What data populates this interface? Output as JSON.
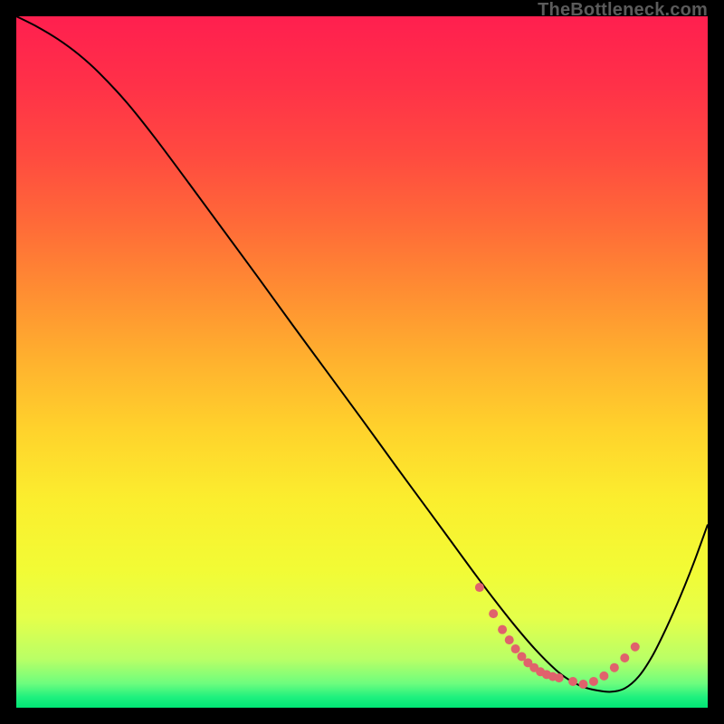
{
  "watermark": "TheBottleneck.com",
  "chart_data": {
    "type": "line",
    "title": "",
    "xlabel": "",
    "ylabel": "",
    "xlim": [
      0,
      100
    ],
    "ylim": [
      0,
      100
    ],
    "background_gradient_stops": [
      {
        "offset": 0.0,
        "color": "#ff1f4f"
      },
      {
        "offset": 0.1,
        "color": "#ff3148"
      },
      {
        "offset": 0.2,
        "color": "#ff4a40"
      },
      {
        "offset": 0.3,
        "color": "#ff6a38"
      },
      {
        "offset": 0.4,
        "color": "#ff8e32"
      },
      {
        "offset": 0.5,
        "color": "#ffb22e"
      },
      {
        "offset": 0.6,
        "color": "#ffd32c"
      },
      {
        "offset": 0.7,
        "color": "#fbee2e"
      },
      {
        "offset": 0.8,
        "color": "#f2fb35"
      },
      {
        "offset": 0.87,
        "color": "#e5ff4a"
      },
      {
        "offset": 0.93,
        "color": "#b9ff66"
      },
      {
        "offset": 0.965,
        "color": "#6dfd7e"
      },
      {
        "offset": 0.985,
        "color": "#1ef07e"
      },
      {
        "offset": 1.0,
        "color": "#00e574"
      }
    ],
    "series": [
      {
        "name": "bottleneck-curve",
        "color": "#000000",
        "x": [
          0,
          3,
          6,
          9,
          12,
          16,
          20,
          25,
          30,
          35,
          40,
          45,
          50,
          55,
          60,
          63,
          66,
          69,
          72,
          75,
          78,
          80,
          82,
          84,
          86,
          88,
          90,
          92,
          94,
          96,
          98,
          100
        ],
        "y": [
          100,
          98.5,
          96.7,
          94.5,
          91.8,
          87.5,
          82.5,
          75.8,
          69.0,
          62.2,
          55.3,
          48.5,
          41.7,
          34.8,
          28.0,
          23.9,
          19.8,
          15.8,
          12.0,
          8.5,
          5.5,
          4.0,
          3.0,
          2.5,
          2.3,
          2.8,
          4.5,
          7.5,
          11.5,
          16.0,
          21.0,
          26.5
        ]
      }
    ],
    "markers": {
      "name": "bottleneck-range",
      "color": "#e0626c",
      "radius_px": 5,
      "x": [
        67.0,
        69.0,
        70.3,
        71.3,
        72.2,
        73.1,
        74.0,
        74.9,
        75.8,
        76.7,
        77.6,
        78.5,
        80.5,
        82.0,
        83.5,
        85.0,
        86.5,
        88.0,
        89.5
      ],
      "y": [
        17.4,
        13.6,
        11.3,
        9.8,
        8.5,
        7.4,
        6.5,
        5.8,
        5.2,
        4.8,
        4.5,
        4.3,
        3.8,
        3.4,
        3.8,
        4.6,
        5.8,
        7.2,
        8.8
      ]
    }
  }
}
